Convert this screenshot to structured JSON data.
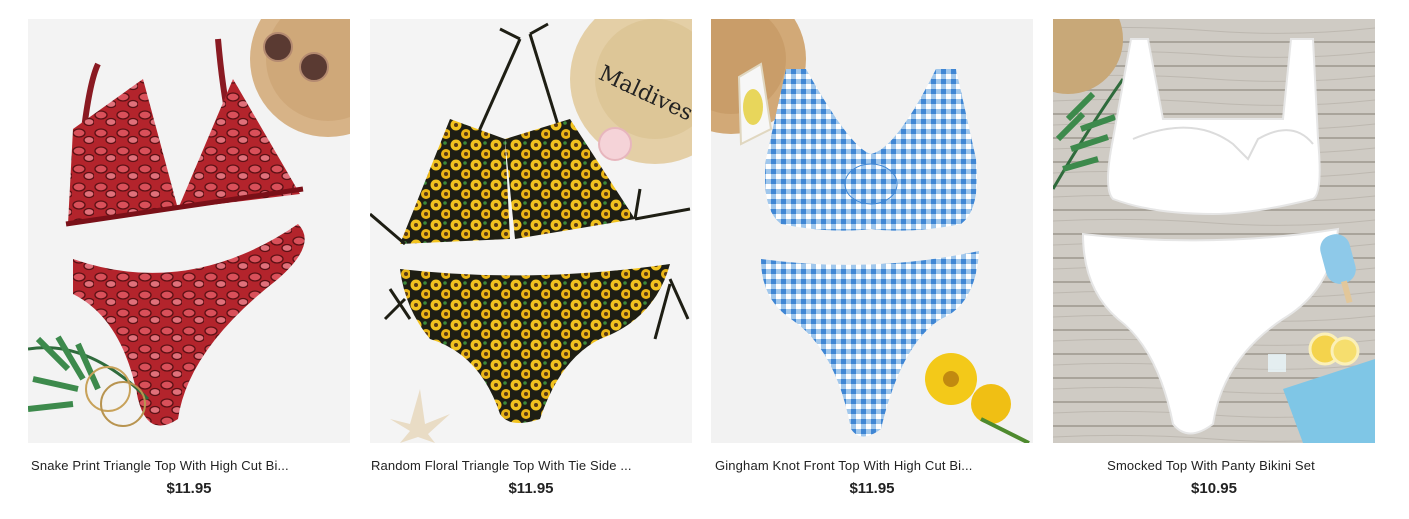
{
  "products": [
    {
      "name": "Snake Print Triangle Top With High Cut Bi...",
      "price": "$11.95",
      "image": "red-snake-print-bikini"
    },
    {
      "name": "Random Floral Triangle Top With Tie Side ...",
      "price": "$11.95",
      "image": "sunflower-print-bikini"
    },
    {
      "name": "Gingham Knot Front Top With High Cut Bi...",
      "price": "$11.95",
      "image": "blue-gingham-bikini"
    },
    {
      "name": "Smocked Top With Panty Bikini Set",
      "price": "$10.95",
      "image": "white-smocked-bikini"
    }
  ]
}
